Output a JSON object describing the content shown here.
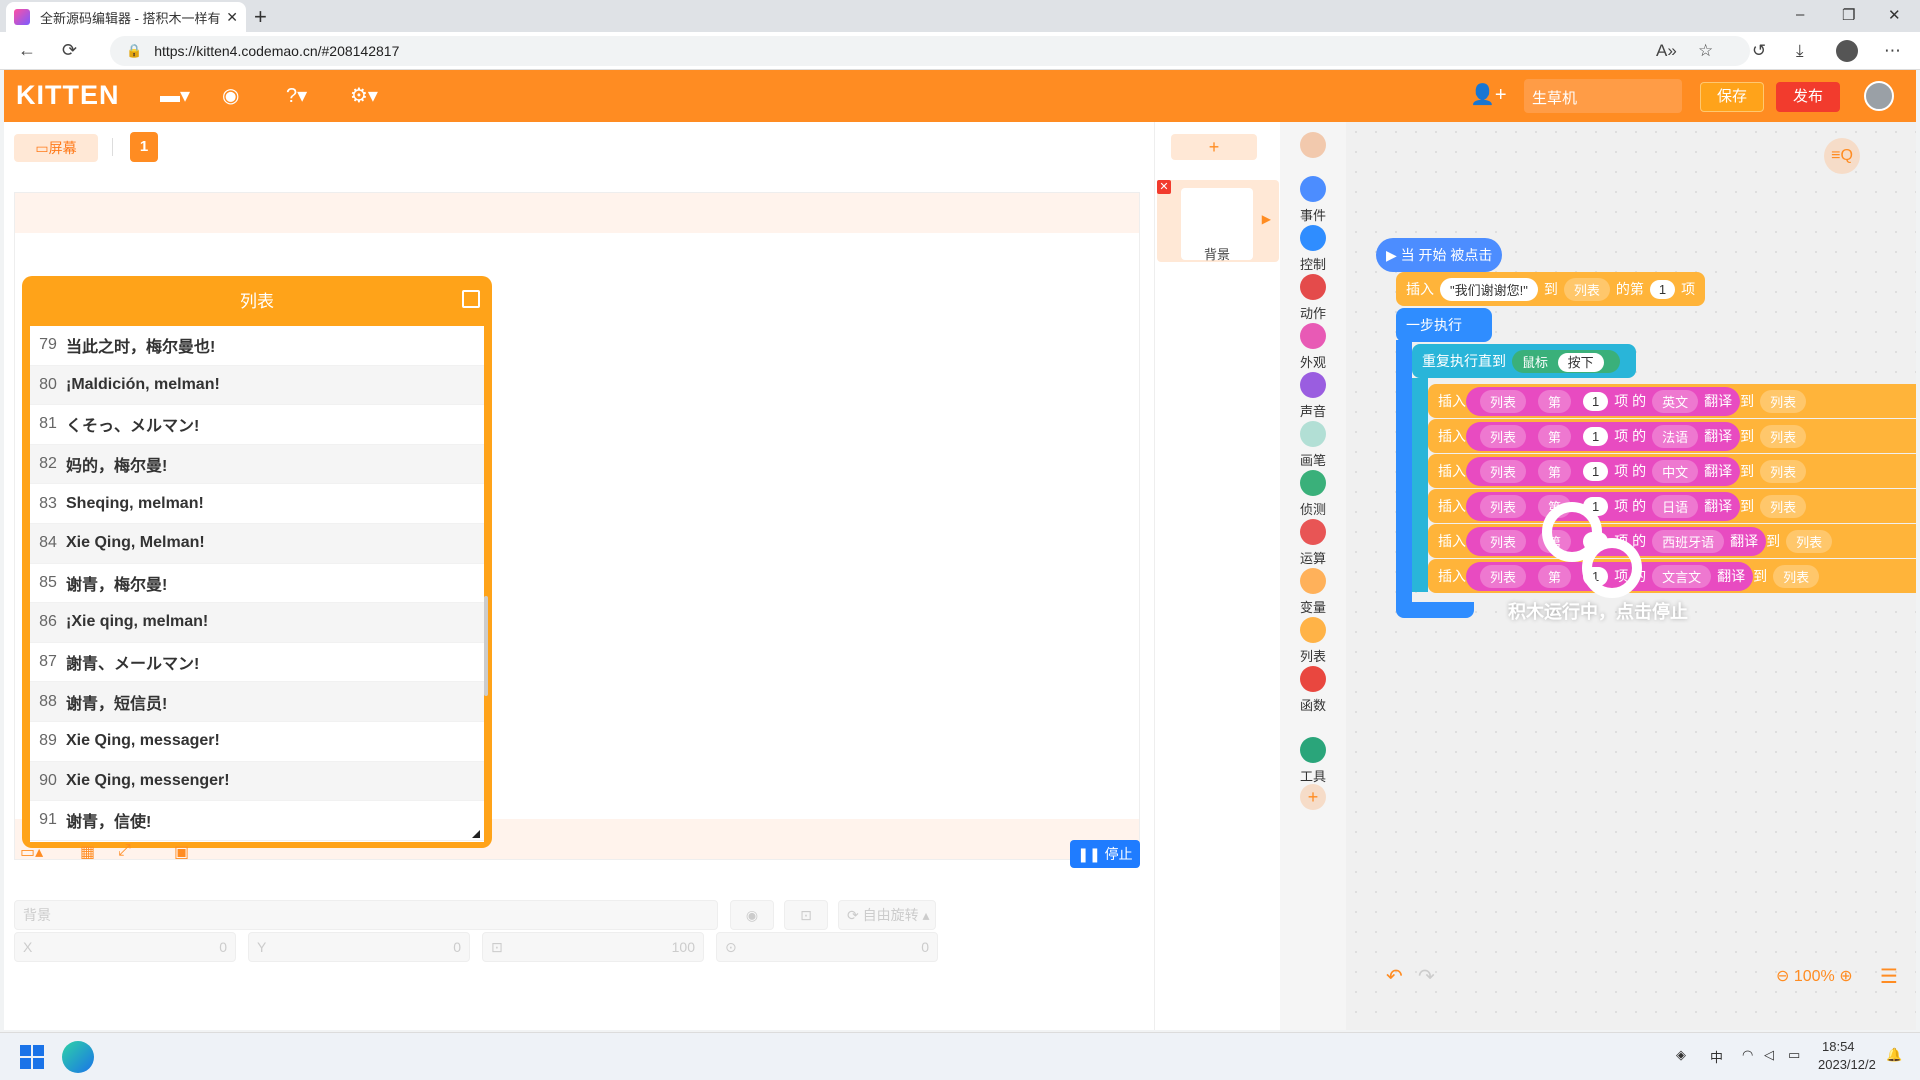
{
  "browser": {
    "tab_title": "全新源码编辑器 - 搭积木一样有趣",
    "url": "https://kitten4.codemao.cn/#208142817",
    "new_tab": "+",
    "close": "✕",
    "back": "←",
    "reload": "⟳",
    "lock": "🔒",
    "win_min": "–",
    "win_max": "❐",
    "win_close": "✕"
  },
  "header": {
    "logo": "KITTEN",
    "project_name": "生草机",
    "save": "保存",
    "publish": "发布"
  },
  "stage": {
    "screen_label": "屏幕",
    "page_num": "1",
    "list_title": "列表",
    "list_items": [
      {
        "idx": "79",
        "val": "当此之时，梅尔曼也!"
      },
      {
        "idx": "80",
        "val": "¡Maldición, melman!"
      },
      {
        "idx": "81",
        "val": "くそっ、メルマン!"
      },
      {
        "idx": "82",
        "val": "妈的，梅尔曼!"
      },
      {
        "idx": "83",
        "val": "Sheqing, melman!"
      },
      {
        "idx": "84",
        "val": "Xie Qing, Melman!"
      },
      {
        "idx": "85",
        "val": "谢青，梅尔曼!"
      },
      {
        "idx": "86",
        "val": "¡Xie qing, melman!"
      },
      {
        "idx": "87",
        "val": "謝青、メールマン!"
      },
      {
        "idx": "88",
        "val": "谢青，短信员!"
      },
      {
        "idx": "89",
        "val": "Xie Qing, messager!"
      },
      {
        "idx": "90",
        "val": "Xie Qing, messenger!"
      },
      {
        "idx": "91",
        "val": "谢青，信使!"
      }
    ],
    "stop_button": "停止",
    "prop_bg_placeholder": "背景",
    "rotate_label": "自由旋转",
    "x_label": "X",
    "x_value": "0",
    "y_label": "Y",
    "y_value": "0",
    "size_value": "100",
    "dir_value": "0"
  },
  "sprites": {
    "add": "+",
    "background_label": "背景"
  },
  "categories": [
    {
      "label": "事件",
      "color": "#4c8dff"
    },
    {
      "label": "控制",
      "color": "#2f8dff"
    },
    {
      "label": "动作",
      "color": "#e44b4b"
    },
    {
      "label": "外观",
      "color": "#e85ab5"
    },
    {
      "label": "声音",
      "color": "#9a5de0"
    },
    {
      "label": "画笔",
      "color": "#b2dfd5"
    },
    {
      "label": "侦测",
      "color": "#3ab07a"
    },
    {
      "label": "运算",
      "color": "#e85555"
    },
    {
      "label": "变量",
      "color": "#ffb15a"
    },
    {
      "label": "列表",
      "color": "#ffb347"
    },
    {
      "label": "函数",
      "color": "#e9473f"
    },
    {
      "label": "工具",
      "color": "#2aa57a"
    }
  ],
  "workspace": {
    "hat": "当 开始 被点击",
    "insert_label": "插入",
    "insert_text": "\"我们谢谢您!\"",
    "to_label": "到",
    "list_label": "列表",
    "the_label": "的第",
    "item_label": "项",
    "one": "1",
    "step_run": "一步执行",
    "repeat_until": "重复执行直到",
    "mouse": "鼠标",
    "pressed": "按下",
    "di": "第",
    "de": "的",
    "translate": "翻译",
    "languages": [
      "英文",
      "法语",
      "中文",
      "日语",
      "西班牙语",
      "文言文"
    ],
    "running_overlay": "积木运行中，点击停止",
    "zoom_level": "100%"
  },
  "taskbar": {
    "ime": "中",
    "time": "18:54",
    "date": "2023/12/2"
  }
}
